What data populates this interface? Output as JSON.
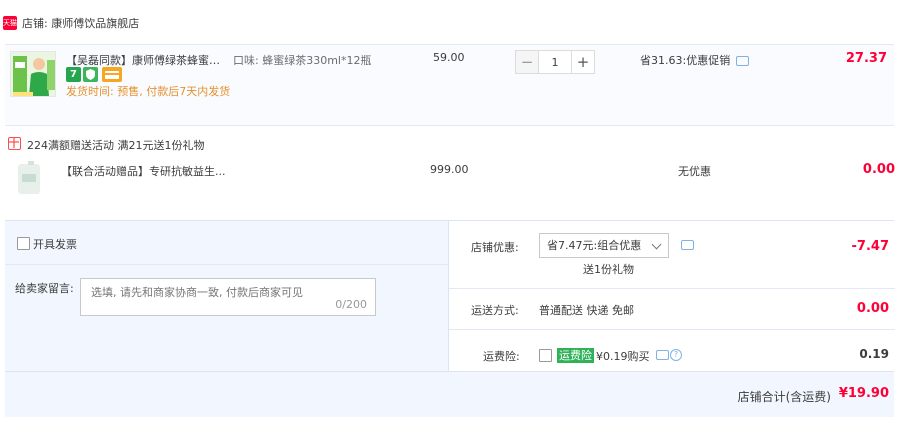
{
  "store": {
    "badge": "天猫",
    "label": "店铺: 康师傅饮品旗舰店"
  },
  "product": {
    "title": "【吴磊同款】康师傅绿茶蜂蜜味...",
    "sku": "口味: 蜂蜜绿茶330ml*12瓶",
    "shipping_note": "发货时间: 预售, 付款后7天内发货",
    "unit_price": "59.00",
    "quantity": "1",
    "minus_label": "−",
    "plus_label": "+",
    "promo": "省31.63:优惠促销",
    "row_total": "27.37",
    "tag_seven": "7"
  },
  "gift": {
    "title": "224满额赠送活动   满21元送1份礼物",
    "name": "【联合活动赠品】专研抗敏益生...",
    "price": "999.00",
    "promo": "无优惠",
    "row_total": "0.00"
  },
  "settlement": {
    "invoice_label": "开具发票",
    "message_label": "给卖家留言:",
    "message_placeholder": "选填, 请先和商家协商一致, 付款后商家可见",
    "message_count": "0/200",
    "discount_label": "店铺优惠:",
    "discount_select": "省7.47元:组合优惠",
    "discount_note": "送1份礼物",
    "discount_value": "-7.47",
    "shipping_label": "运送方式:",
    "shipping_value_text": "普通配送 快递 免邮",
    "shipping_value": "0.00",
    "insurance_label": "运费险:",
    "insurance_badge": "运费险",
    "insurance_price": "¥0.19购买",
    "insurance_value": "0.19",
    "total_label": "店铺合计(含运费)",
    "total_value": "¥19.90"
  },
  "colors": {
    "accent_red": "#ff0036",
    "orange_note": "#e4922d",
    "insurance_green": "#2fb257",
    "panel_blue": "#f2f7ff"
  }
}
